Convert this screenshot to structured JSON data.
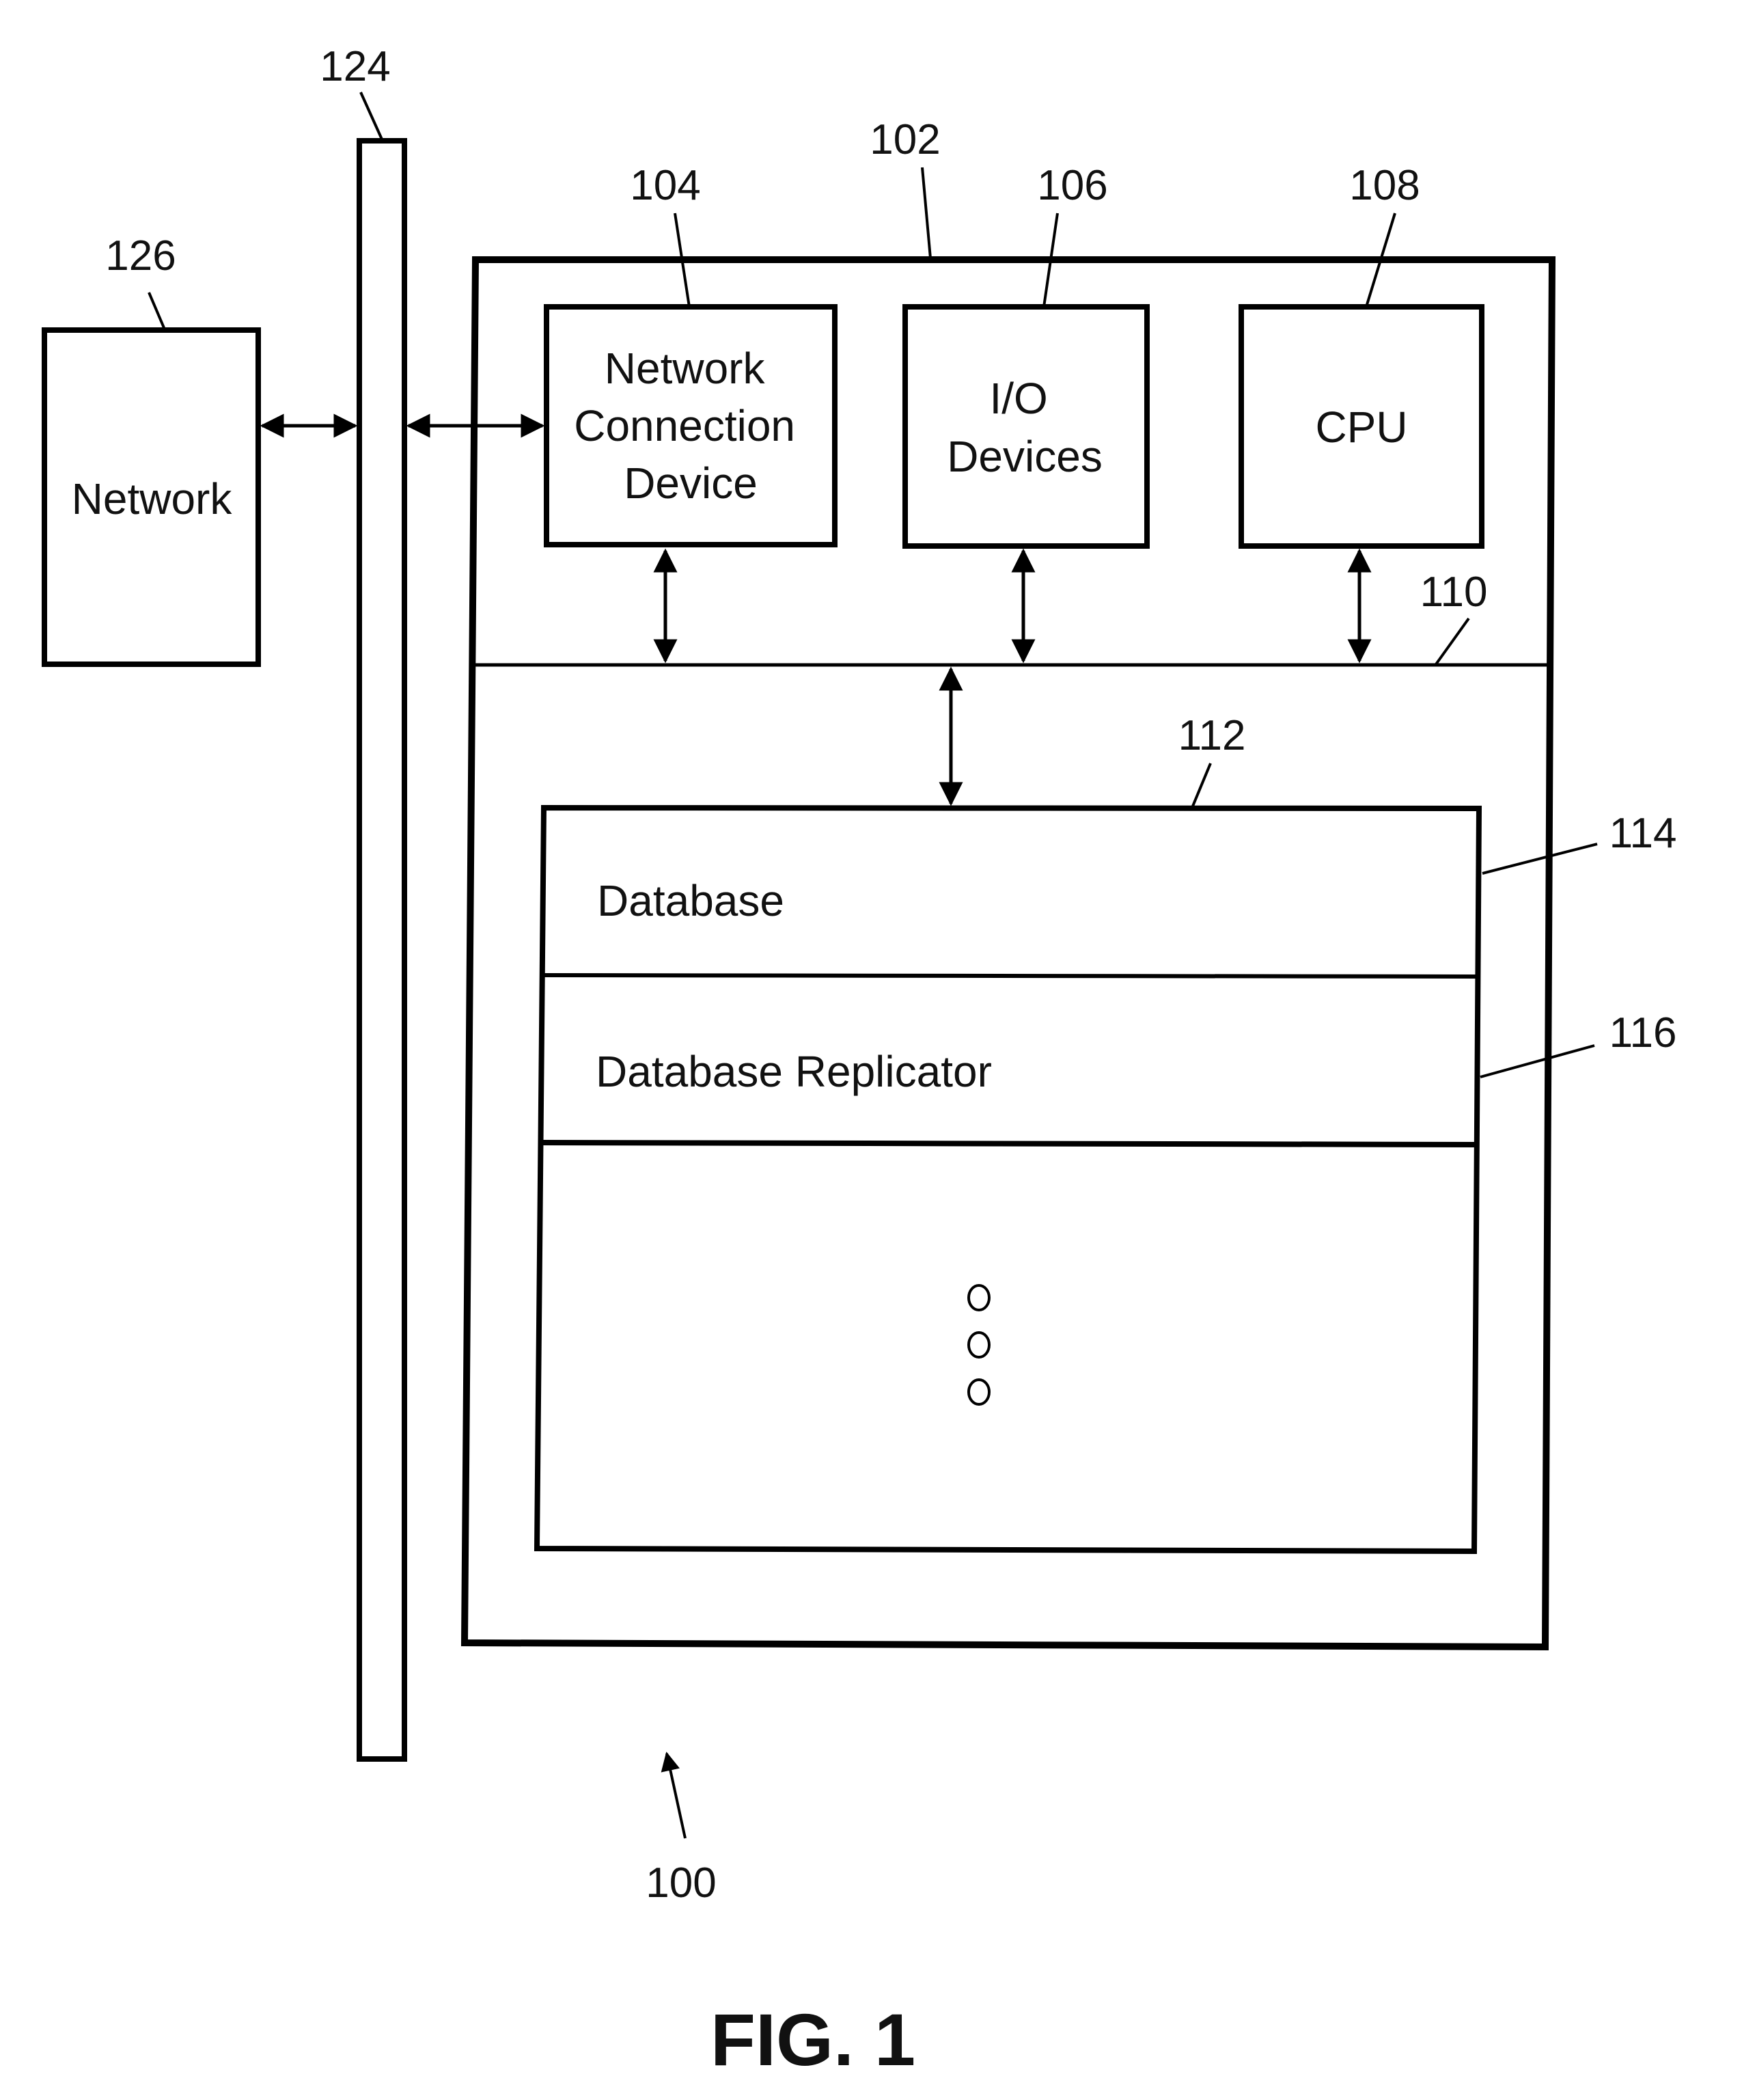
{
  "figure": {
    "caption": "FIG. 1",
    "system_ref": "100"
  },
  "network": {
    "ref": "126",
    "label": "Network"
  },
  "bus": {
    "ref": "124"
  },
  "computer": {
    "ref": "102",
    "components": [
      {
        "ref": "104",
        "lines": [
          "Network",
          "Connection",
          "Device"
        ]
      },
      {
        "ref": "106",
        "lines": [
          "I/O",
          "Devices"
        ]
      },
      {
        "ref": "108",
        "lines": [
          "CPU"
        ]
      }
    ],
    "internal_bus": {
      "ref": "110"
    },
    "memory": {
      "ref": "112",
      "sections": [
        {
          "ref": "114",
          "label": "Database"
        },
        {
          "ref": "116",
          "label": "Database Replicator"
        }
      ],
      "continuation": "ellipsis"
    }
  },
  "colors": {
    "ink": "#000000",
    "background": "#ffffff"
  }
}
